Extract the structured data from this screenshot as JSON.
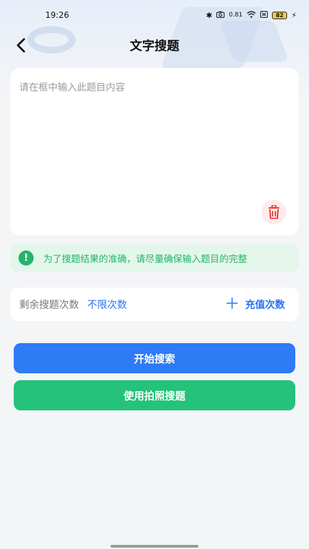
{
  "status_bar": {
    "time": "19:26",
    "net_speed": "0.81",
    "battery": "82"
  },
  "nav": {
    "title": "文字搜题"
  },
  "input": {
    "placeholder": "请在框中输入此题目内容",
    "value": ""
  },
  "tip": {
    "text": "为了搜题结果的准确，请尽量确保输入题目的完整"
  },
  "quota": {
    "label": "剩余搜题次数",
    "value": "不限次数",
    "recharge_label": "充值次数"
  },
  "buttons": {
    "search_label": "开始搜索",
    "photo_label": "使用拍照搜题"
  },
  "colors": {
    "primary_blue": "#2d7bf5",
    "primary_green": "#24c27a",
    "tip_bg": "#e4f6ec",
    "trash_red": "#e8372f"
  }
}
